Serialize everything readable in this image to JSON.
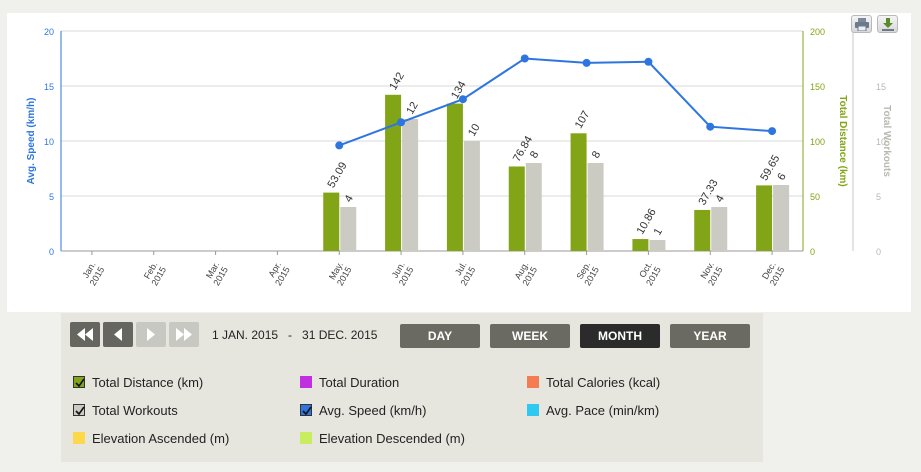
{
  "chart_data": {
    "type": "bar",
    "categories": [
      "Jan. 2015",
      "Feb. 2015",
      "Mar. 2015",
      "Apr. 2015",
      "May. 2015",
      "Jun. 2015",
      "Jul. 2015",
      "Aug. 2015",
      "Sep. 2015",
      "Oct. 2015",
      "Nov. 2015",
      "Dec. 2015"
    ],
    "series": [
      {
        "name": "Total Distance (km)",
        "kind": "bar",
        "axis": "right",
        "color": "#82a417",
        "values": [
          null,
          null,
          null,
          null,
          53.09,
          142,
          134,
          76.84,
          107,
          10.86,
          37.33,
          59.65
        ],
        "labels": [
          null,
          null,
          null,
          null,
          "53.09",
          "142",
          "134",
          "76.84",
          "107",
          "10.86",
          "37.33",
          "59.65"
        ]
      },
      {
        "name": "Total Workouts",
        "kind": "bar",
        "axis": "right2",
        "color": "#cbcbc3",
        "values": [
          null,
          null,
          null,
          null,
          4,
          12,
          10,
          8,
          8,
          1,
          4,
          6
        ],
        "labels": [
          null,
          null,
          null,
          null,
          "4",
          "12",
          "10",
          "8",
          "8",
          "1",
          "4",
          "6"
        ]
      },
      {
        "name": "Avg. Speed (km/h)",
        "kind": "line",
        "axis": "left",
        "color": "#2f75e0",
        "values": [
          null,
          null,
          null,
          null,
          9.6,
          11.7,
          13.8,
          17.5,
          17.1,
          17.2,
          11.3,
          10.9
        ]
      }
    ],
    "axes": {
      "left": {
        "label": "Avg. Speed (km/h)",
        "min": 0,
        "max": 20,
        "ticks": [
          "0",
          "5",
          "10",
          "15",
          "20"
        ],
        "color": "#2f75e0"
      },
      "right": {
        "label": "Total Distance (km)",
        "min": 0,
        "max": 200,
        "ticks": [
          "0",
          "50",
          "100",
          "150",
          "200"
        ],
        "color": "#82a417"
      },
      "right2": {
        "label": "Total Workouts",
        "min": 0,
        "max": 20,
        "ticks": [
          "0",
          "5",
          "10",
          "15"
        ],
        "color": "#b8b8b0"
      }
    },
    "grid": true
  },
  "toolbar": {
    "print_icon": "printer-icon",
    "download_icon": "download-icon"
  },
  "controls": {
    "date_range": "1 JAN. 2015   -   31 DEC. 2015",
    "nav_icons": [
      "rewind-icon",
      "previous-icon",
      "next-icon",
      "fast-forward-icon"
    ],
    "periods": [
      "DAY",
      "WEEK",
      "MONTH",
      "YEAR"
    ],
    "selected_period": "MONTH"
  },
  "legend": [
    {
      "label": "Total Distance (km)",
      "color": "#82a417",
      "checked": true
    },
    {
      "label": "Total Duration",
      "color": "#c030e0",
      "checked": false
    },
    {
      "label": "Total Calories (kcal)",
      "color": "#f47c50",
      "checked": false
    },
    {
      "label": "Total Workouts",
      "color": "#cbcbc3",
      "checked": true
    },
    {
      "label": "Avg. Speed (km/h)",
      "color": "#2f75e0",
      "checked": true
    },
    {
      "label": "Avg. Pace (min/km)",
      "color": "#2ec8f0",
      "checked": false
    },
    {
      "label": "Elevation Ascended (m)",
      "color": "#fdd84a",
      "checked": false
    },
    {
      "label": "Elevation Descended (m)",
      "color": "#c8ee60",
      "checked": false
    }
  ]
}
